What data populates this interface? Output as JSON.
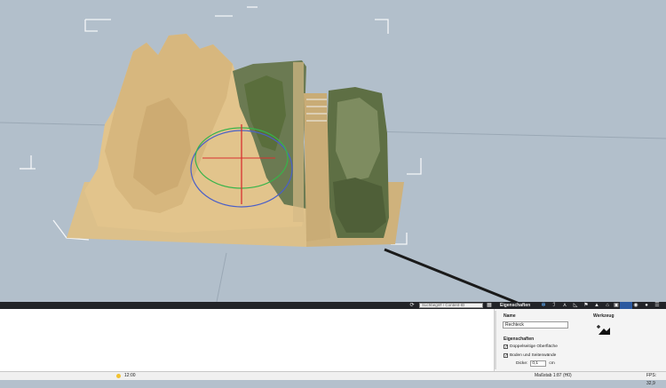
{
  "toolbar": {
    "search_placeholder": "Suchbegriff / Content-ID",
    "panel_tab": "Eigenschaften"
  },
  "properties": {
    "name_label": "Name",
    "name_value": "Rechteck",
    "tool_label": "Werkzeug",
    "section_title": "Eigenschaften",
    "double_sided": {
      "label": "Doppelseitige Oberfläche",
      "checked": true
    },
    "floor_walls": {
      "label": "Boden und Seitenwände",
      "checked": true
    },
    "thickness_label": "Dicke:",
    "thickness_value": "0,1",
    "thickness_unit": "cm"
  },
  "status": {
    "time": "12:00",
    "scale": "Maßstab 1:87 (H0)",
    "fps": "FPS: 32,9"
  },
  "colors": {
    "viewport_bg": "#b2bfcb",
    "terrain_sand": "#e2c48c",
    "terrain_green": "#5a6e3c",
    "toolbar_bg": "#222428"
  }
}
